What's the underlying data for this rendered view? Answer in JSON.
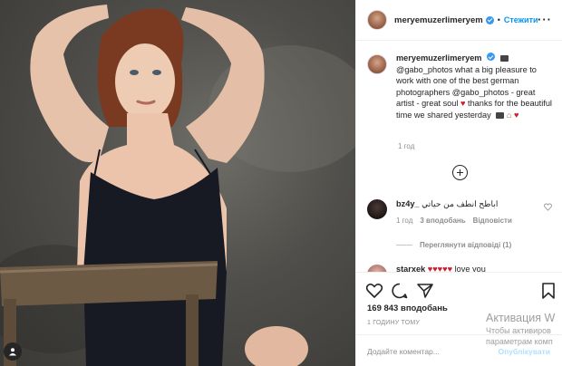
{
  "post": {
    "username": "meryemuzerlimeryem",
    "follow_label": "Стежити",
    "separator": "•",
    "more_label": "···",
    "caption": {
      "username": "meryemuzerlimeryem",
      "text": "@gabo_photos what a big pleasure to work with one of the best german photographers @gabo_photos - great artist - great soul",
      "text_after_heart": "thanks for the beautiful time we shared yesterday",
      "time": "1 год"
    },
    "comments": [
      {
        "username": "bz4y_",
        "text": "اباطح انطف من حياتي",
        "time": "1 год",
        "likes": "3 вподобань",
        "reply_label": "Відповісти",
        "view_replies": "Переглянути відповіді (1)"
      },
      {
        "username": "starxek",
        "text": "love you"
      }
    ],
    "likes_count": "169 843 вподобань",
    "posted_ago": "1 ГОДИНУ ТОМУ",
    "comment_placeholder": "Додайте коментар...",
    "post_button": "Опублікувати"
  },
  "icons": [
    "verified-badge-icon",
    "camera-icon",
    "heart-icon",
    "add-comment-icon",
    "like-icon",
    "comment-icon",
    "share-icon",
    "save-icon",
    "profile-icon"
  ],
  "colors": {
    "accent": "#0095f6",
    "heart": "#d11a2a",
    "muted": "#8e8e8e"
  },
  "watermark": {
    "line1": "Активация W",
    "line2": "Чтобы активиров",
    "line3": "параметрам комп"
  }
}
